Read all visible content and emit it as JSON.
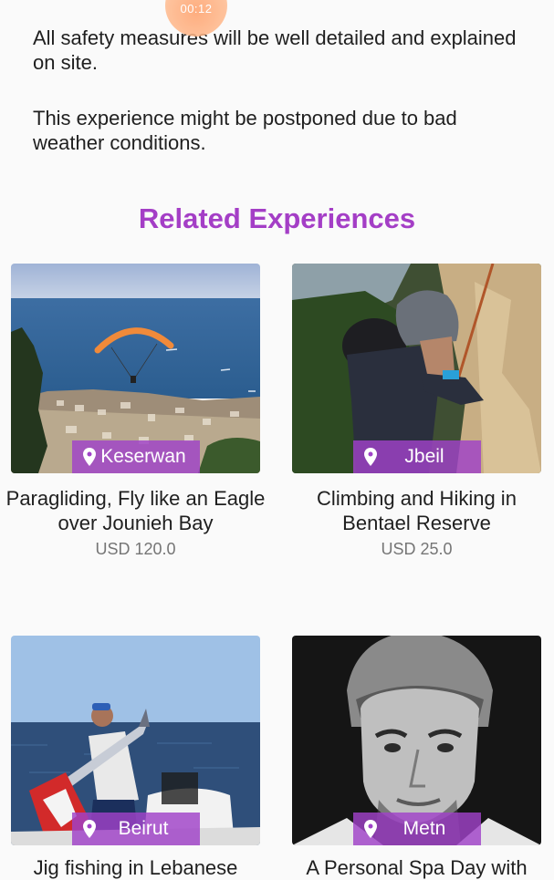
{
  "timer": {
    "text": "00:12"
  },
  "details": {
    "safety_note": "All safety measures will be well detailed and explained on site.",
    "weather_note": "This experience might be postponed due to bad weather conditions."
  },
  "related": {
    "title": "Related Experiences",
    "cards": [
      {
        "location": "Keserwan",
        "title": "Paragliding, Fly like an Eagle over Jounieh Bay",
        "price": "USD 120.0"
      },
      {
        "location": "Jbeil",
        "title": "Climbing and Hiking in Bentael Reserve",
        "price": "USD 25.0"
      },
      {
        "location": "Beirut",
        "title": "Jig fishing in Lebanese",
        "price": ""
      },
      {
        "location": "Metn",
        "title": "A Personal Spa Day with",
        "price": ""
      }
    ]
  },
  "colors": {
    "accent": "#a43ec6",
    "badge": "#a042c8",
    "price": "#757575"
  },
  "icons": {
    "location": "location-pin-icon"
  }
}
